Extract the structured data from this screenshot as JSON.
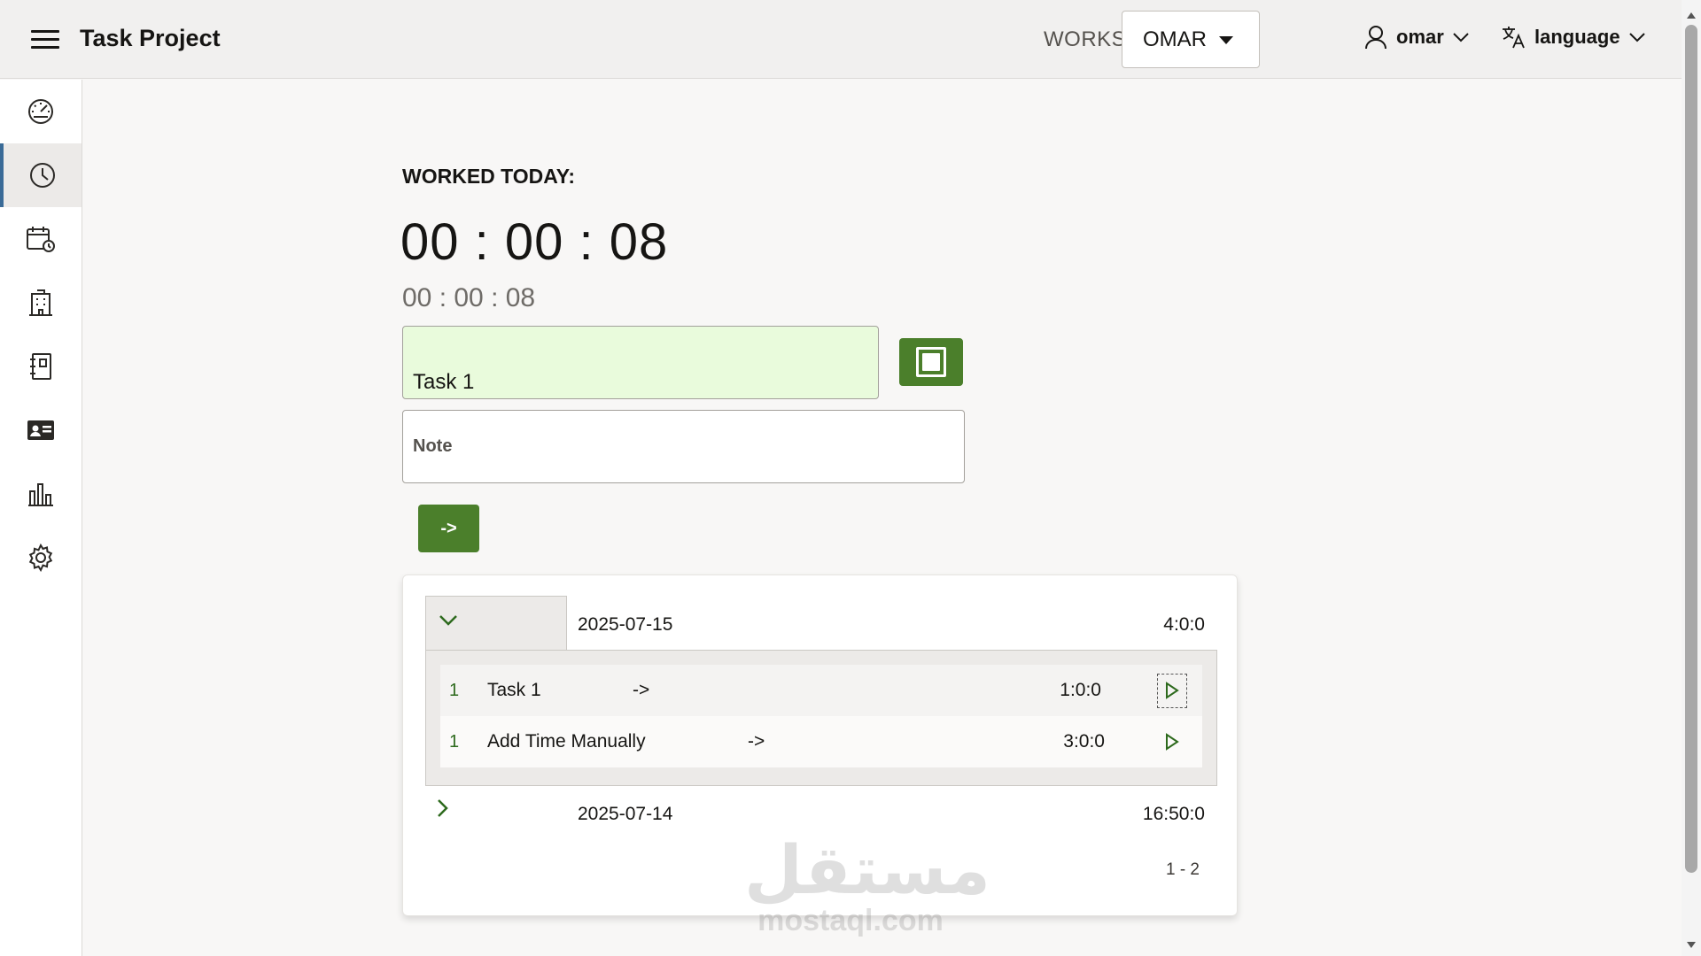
{
  "header": {
    "app_title": "Task Project",
    "works_label": "WORKS",
    "works_selected": "OMAR",
    "user_name": "omar",
    "language_label": "language"
  },
  "sidebar": {
    "items": [
      {
        "icon": "dashboard-gauge-icon",
        "active": false
      },
      {
        "icon": "clock-icon",
        "active": true
      },
      {
        "icon": "calendar-clock-icon",
        "active": false
      },
      {
        "icon": "building-icon",
        "active": false
      },
      {
        "icon": "notebook-icon",
        "active": false
      },
      {
        "icon": "id-card-icon",
        "active": false
      },
      {
        "icon": "bar-chart-icon",
        "active": false
      },
      {
        "icon": "gear-icon",
        "active": false
      }
    ]
  },
  "main": {
    "worked_today_label": "WORKED TODAY:",
    "timer_big": "00 : 00 : 08",
    "timer_small": "00 : 00 : 08",
    "task_input_value": "Task 1",
    "note_placeholder": "Note",
    "submit_label": "->"
  },
  "entries": {
    "groups": [
      {
        "date": "2025-07-15",
        "total": "4:0:0",
        "expanded": true,
        "rows": [
          {
            "num": "1",
            "name": "Task 1",
            "arrow": "->",
            "duration": "1:0:0"
          },
          {
            "num": "1",
            "name": "Add Time Manually",
            "arrow": "->",
            "duration": "3:0:0"
          }
        ]
      },
      {
        "date": "2025-07-14",
        "total": "16:50:0",
        "expanded": false
      }
    ],
    "pagination": "1 - 2"
  },
  "watermark": {
    "arabic": "مستقل",
    "latin": "mostaql.com"
  },
  "colors": {
    "accent_green": "#4b7f2b",
    "active_bar": "#3a6b97",
    "task_input_bg": "#e9fbdc"
  }
}
